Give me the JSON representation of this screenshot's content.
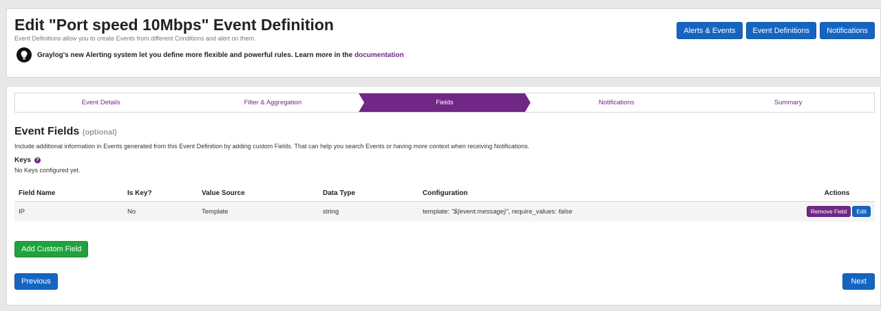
{
  "header": {
    "title": "Edit \"Port speed 10Mbps\" Event Definition",
    "subtitle": "Event Definitions allow you to create Events from different Conditions and alert on them.",
    "notice_text": "Graylog's new Alerting system let you define more flexible and powerful rules. Learn more in the ",
    "notice_link": "documentation",
    "notice_icon": "lightbulb-icon",
    "buttons": {
      "alerts_events": "Alerts & Events",
      "event_definitions": "Event Definitions",
      "notifications": "Notifications"
    }
  },
  "wizard": {
    "steps": [
      "Event Details",
      "Filter & Aggregation",
      "Fields",
      "Notifications",
      "Summary"
    ],
    "active_step": "Fields"
  },
  "fields_section": {
    "title": "Event Fields",
    "optional": "(optional)",
    "description": "Include additional information in Events generated from this Event Definition by adding custom Fields. That can help you search Events or having more context when receiving Notifications.",
    "keys_label": "Keys",
    "keys_empty": "No Keys configured yet.",
    "table": {
      "columns": [
        "Field Name",
        "Is Key?",
        "Value Source",
        "Data Type",
        "Configuration",
        "Actions"
      ],
      "rows": [
        {
          "field_name": "IP",
          "is_key": "No",
          "value_source": "Template",
          "data_type": "string",
          "config_prefix": "template: ",
          "config_template": "\"${event.message}\"",
          "config_middle": ", require_values: ",
          "config_require": "false",
          "remove_label": "Remove Field",
          "edit_label": "Edit"
        }
      ]
    },
    "add_label": "Add Custom Field"
  },
  "footer": {
    "previous_label": "Previous",
    "next_label": "Next"
  },
  "colors": {
    "primary_blue": "#1565c0",
    "brand_purple": "#702785",
    "success_green": "#20a33f"
  }
}
